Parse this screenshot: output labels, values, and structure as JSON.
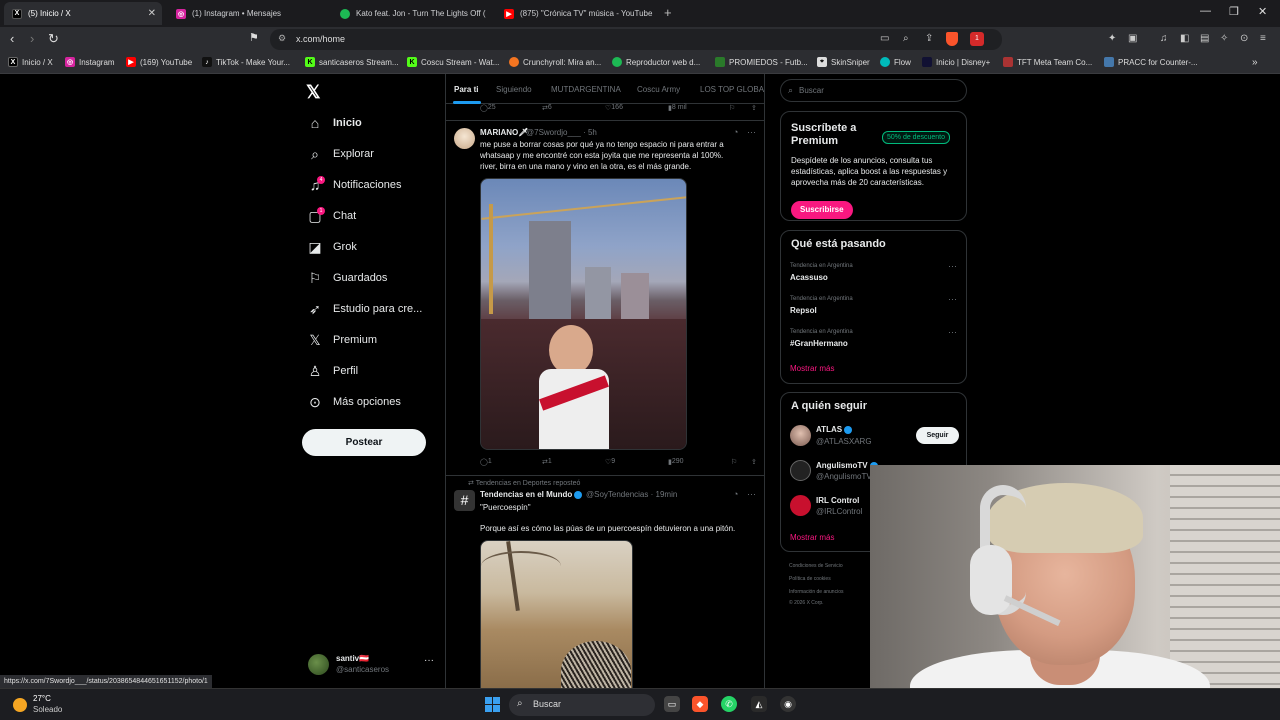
{
  "browser": {
    "tabs": [
      {
        "title": "(5) Inicio / X",
        "active": true
      },
      {
        "title": "(1) Instagram • Mensajes",
        "active": false
      },
      {
        "title": "Kato feat. Jon - Turn The Lights Off (",
        "active": false
      },
      {
        "title": "(875) \"Crónica TV\" música - YouTube",
        "active": false
      }
    ],
    "url": "x.com/home",
    "bookmarks": [
      "Inicio / X",
      "Instagram",
      "(169) YouTube",
      "TikTok - Make Your...",
      "santicaseros Stream...",
      "Coscu Stream - Wat...",
      "Crunchyroll: Mira an...",
      "Reproductor web d...",
      "PROMIEDOS - Futb...",
      "SkinSniper",
      "Flow",
      "Inicio | Disney+",
      "TFT Meta Team Co...",
      "PRACC for Counter-..."
    ],
    "extension_badge": "1",
    "status_url": "https://x.com/7Swordjo___/status/2038654844651651152/photo/1"
  },
  "sidebar": {
    "items": [
      {
        "label": "Inicio",
        "icon": "home-icon"
      },
      {
        "label": "Explorar",
        "icon": "search-icon"
      },
      {
        "label": "Notificaciones",
        "icon": "bell-icon",
        "badge": "4"
      },
      {
        "label": "Chat",
        "icon": "chat-icon",
        "badge": "1"
      },
      {
        "label": "Grok",
        "icon": "grok-icon"
      },
      {
        "label": "Guardados",
        "icon": "bookmark-icon"
      },
      {
        "label": "Estudio para cre...",
        "icon": "rocket-icon"
      },
      {
        "label": "Premium",
        "icon": "x-icon"
      },
      {
        "label": "Perfil",
        "icon": "person-icon"
      },
      {
        "label": "Más opciones",
        "icon": "more-circle-icon"
      }
    ],
    "post_button": "Postear",
    "account": {
      "name": "santiv🇦🇹",
      "handle": "@santicaseros"
    }
  },
  "feed": {
    "tabs": [
      "Para ti",
      "Siguiendo",
      "MUTDARGENTINA",
      "Coscu Army",
      "LOS TOP GLOBAL"
    ],
    "prev_actions": {
      "replies": "25",
      "reposts": "6",
      "likes": "166",
      "views": "8 mil"
    },
    "post1": {
      "name": "MARIANO🗡",
      "handle": "@7Swordjo___",
      "time": "· 5h",
      "text": "me puse a borrar cosas por qué ya no tengo espacio ni para entrar a whatsaap y me encontré con esta joyita que me representa al 100%. river, birra en una mano y vino en la otra, es el más grande.",
      "actions": {
        "replies": "1",
        "reposts": "1",
        "likes": "9",
        "views": "290"
      }
    },
    "post2": {
      "context": "Tendencias en Deportes reposteó",
      "name": "Tendencias en el Mundo",
      "handle": "@SoyTendencias",
      "time": "· 19min",
      "title": "\"Puercoespín\"",
      "text": "Porque así es cómo las púas de un puercoespín detuvieron a una pitón."
    }
  },
  "right": {
    "search_placeholder": "Buscar",
    "premium": {
      "title": "Suscríbete a Premium",
      "discount": "50% de descuento",
      "body": "Despídete de los anuncios, consulta tus estadísticas, aplica boost a las respuestas y aprovecha más de 20 características.",
      "button": "Suscribirse"
    },
    "trends": {
      "title": "Qué está pasando",
      "items": [
        {
          "category": "Tendencia en Argentina",
          "name": "Acassuso"
        },
        {
          "category": "Tendencia en Argentina",
          "name": "Repsol"
        },
        {
          "category": "Tendencia en Argentina",
          "name": "#GranHermano"
        }
      ],
      "show_more": "Mostrar más"
    },
    "follow": {
      "title": "A quién seguir",
      "items": [
        {
          "name": "ATLAS",
          "handle": "@ATLASXARG"
        },
        {
          "name": "AngulismoTV",
          "handle": "@AngulismoTV"
        },
        {
          "name": "IRL Control",
          "handle": "@IRLControl"
        }
      ],
      "button": "Seguir",
      "show_more": "Mostrar más"
    },
    "footer": [
      "Condiciones de Servicio",
      "Política de cookies",
      "Información de anuncios",
      "© 2026 X Corp."
    ]
  },
  "taskbar": {
    "temperature": "27°C",
    "condition": "Soleado",
    "search": "Buscar"
  },
  "colors": {
    "accent": "#1d9bf0",
    "pink": "#f91880",
    "green": "#00ba7c"
  }
}
